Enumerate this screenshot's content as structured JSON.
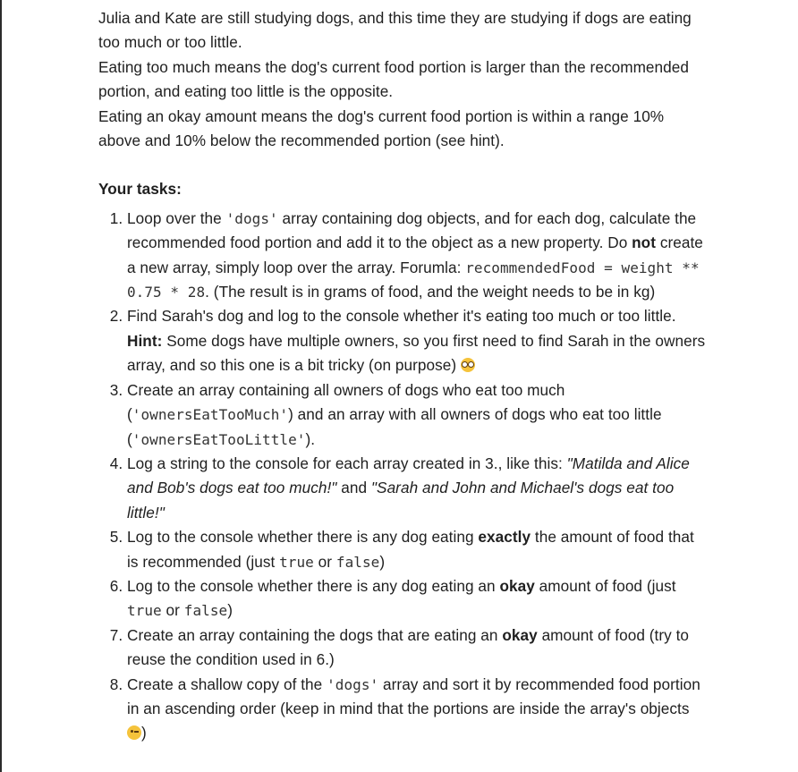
{
  "intro": {
    "p1": "Julia and Kate are still studying dogs, and this time they are studying if dogs are eating too much or too little.",
    "p2": "Eating too much means the dog's current food portion is larger than the recommended portion, and eating too little is the opposite.",
    "p3": "Eating an okay amount means the dog's current food portion is within a range 10% above and 10% below the recommended portion (see hint)."
  },
  "tasks_heading": "Your tasks:",
  "tasks": [
    {
      "a": "Loop over the ",
      "code1": "'dogs'",
      "b": " array containing dog objects, and for each dog, calculate the recommended food portion and add it to the object as a new property. Do ",
      "bold1": "not",
      "c": " create a new array, simply loop over the array. Forumla: ",
      "code2": "recommendedFood = weight ** 0.75 * 28",
      "d": ". (The result is in grams of food, and the weight needs to be in kg)"
    },
    {
      "a": "Find Sarah's dog and log to the console whether it's eating too much or too little. ",
      "bold1": "Hint:",
      "b": " Some dogs have multiple owners, so you first need to find Sarah in the owners array, and so this one is a bit tricky (on purpose) ",
      "emoji": "nerd-face-emoji"
    },
    {
      "a": "Create an array containing all owners of dogs who eat too much (",
      "code1": "'ownersEatTooMuch'",
      "b": ") and an array with all owners of dogs who eat too little (",
      "code2": "'ownersEatTooLittle'",
      "c": ")."
    },
    {
      "a": "Log a string to the console for each array created in 3., like this: ",
      "italic1": "\"Matilda and Alice and Bob's dogs eat too much!\"",
      "b": " and ",
      "italic2": "\"Sarah and John and Michael's dogs eat too little!\""
    },
    {
      "a": "Log to the console whether there is any dog eating ",
      "bold1": "exactly",
      "b": " the amount of food that is recommended (just ",
      "code1": "true",
      "c": " or ",
      "code2": "false",
      "d": ")"
    },
    {
      "a": "Log to the console whether there is any dog eating an ",
      "bold1": "okay",
      "b": " amount of food (just ",
      "code1": "true",
      "c": " or ",
      "code2": "false",
      "d": ")"
    },
    {
      "a": "Create an array containing the dogs that are eating an ",
      "bold1": "okay",
      "b": " amount of food (try to reuse the condition used in 6.)"
    },
    {
      "a": "Create a shallow copy of the ",
      "code1": "'dogs'",
      "b": " array and sort it by recommended food portion in an ascending order (keep in mind that the portions are inside the array's objects ",
      "emoji": "winking-face-emoji",
      "c": ")"
    }
  ]
}
